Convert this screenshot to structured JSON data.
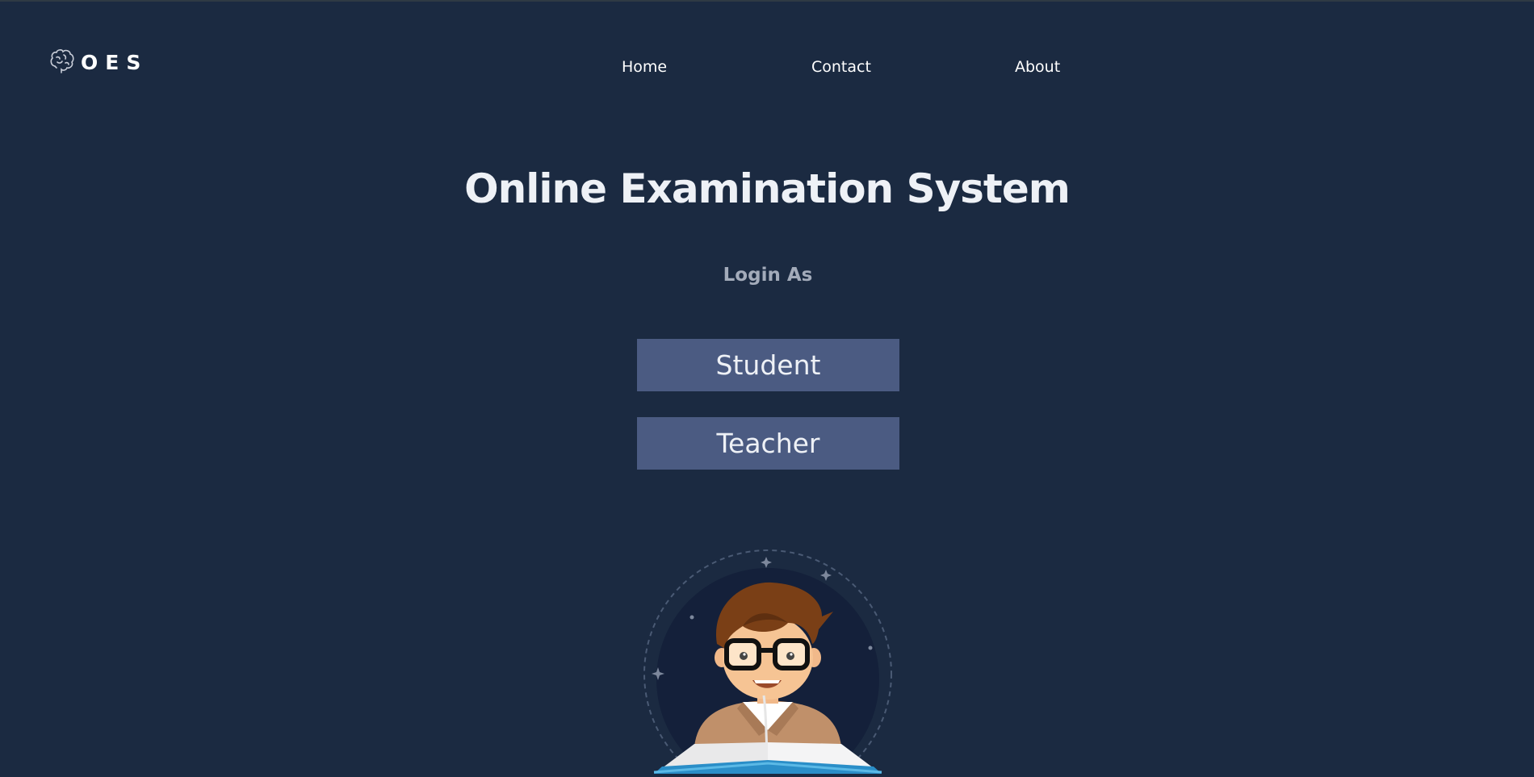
{
  "app": {
    "logo_text": "OES",
    "logo_icon": "brain-icon"
  },
  "nav": {
    "items": [
      {
        "label": "Home"
      },
      {
        "label": "Contact"
      },
      {
        "label": "About"
      }
    ]
  },
  "hero": {
    "title": "Online Examination System",
    "subtitle": "Login As"
  },
  "roles": {
    "student_label": "Student",
    "teacher_label": "Teacher"
  },
  "illustration": {
    "icon": "student-reading-book-illustration"
  },
  "colors": {
    "background": "#1b2a41",
    "button": "#4b5b82",
    "subtitle": "#a3abba",
    "text": "#ffffff"
  }
}
